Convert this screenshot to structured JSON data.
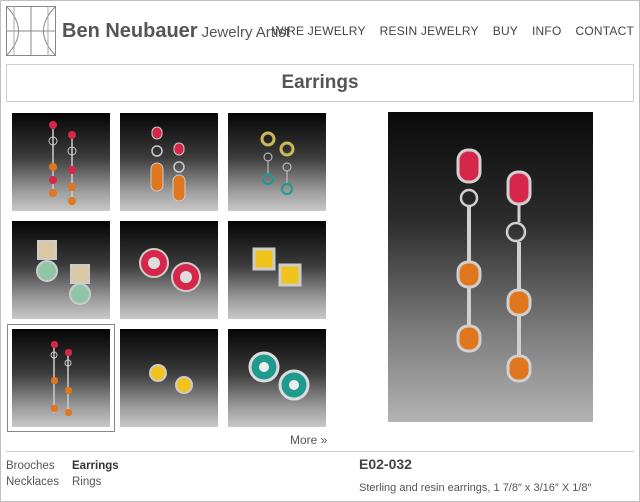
{
  "header": {
    "brand_name": "Ben Neubauer",
    "brand_subtitle": "Jewelry Artist",
    "nav": [
      "WIRE JEWELRY",
      "RESIN JEWELRY",
      "BUY",
      "INFO",
      "CONTACT"
    ]
  },
  "page": {
    "title": "Earrings"
  },
  "gallery": {
    "thumbnails": [
      {
        "icon": "drop-earrings-red-orange-icon"
      },
      {
        "icon": "orange-tube-earrings-icon"
      },
      {
        "icon": "green-ring-drop-earrings-icon"
      },
      {
        "icon": "square-circle-earrings-icon"
      },
      {
        "icon": "red-circle-studs-icon"
      },
      {
        "icon": "yellow-square-studs-icon"
      },
      {
        "icon": "long-drop-earrings-icon"
      },
      {
        "icon": "yellow-circle-studs-icon"
      },
      {
        "icon": "teal-circle-studs-icon"
      }
    ],
    "selected_index": 6,
    "more_label": "More »"
  },
  "footer": {
    "categories": [
      [
        "Brooches",
        "Earrings"
      ],
      [
        "Necklaces",
        "Rings"
      ]
    ],
    "active_category": "Earrings"
  },
  "item": {
    "code": "E02-032",
    "description": "Sterling and resin earrings, 1 7/8″ x 3/16″ X 1/8″"
  },
  "colors": {
    "red": "#d6274a",
    "orange": "#e0761e",
    "yellow": "#f2c31b",
    "teal": "#1e9a8f",
    "silver": "#c9c9c9"
  }
}
